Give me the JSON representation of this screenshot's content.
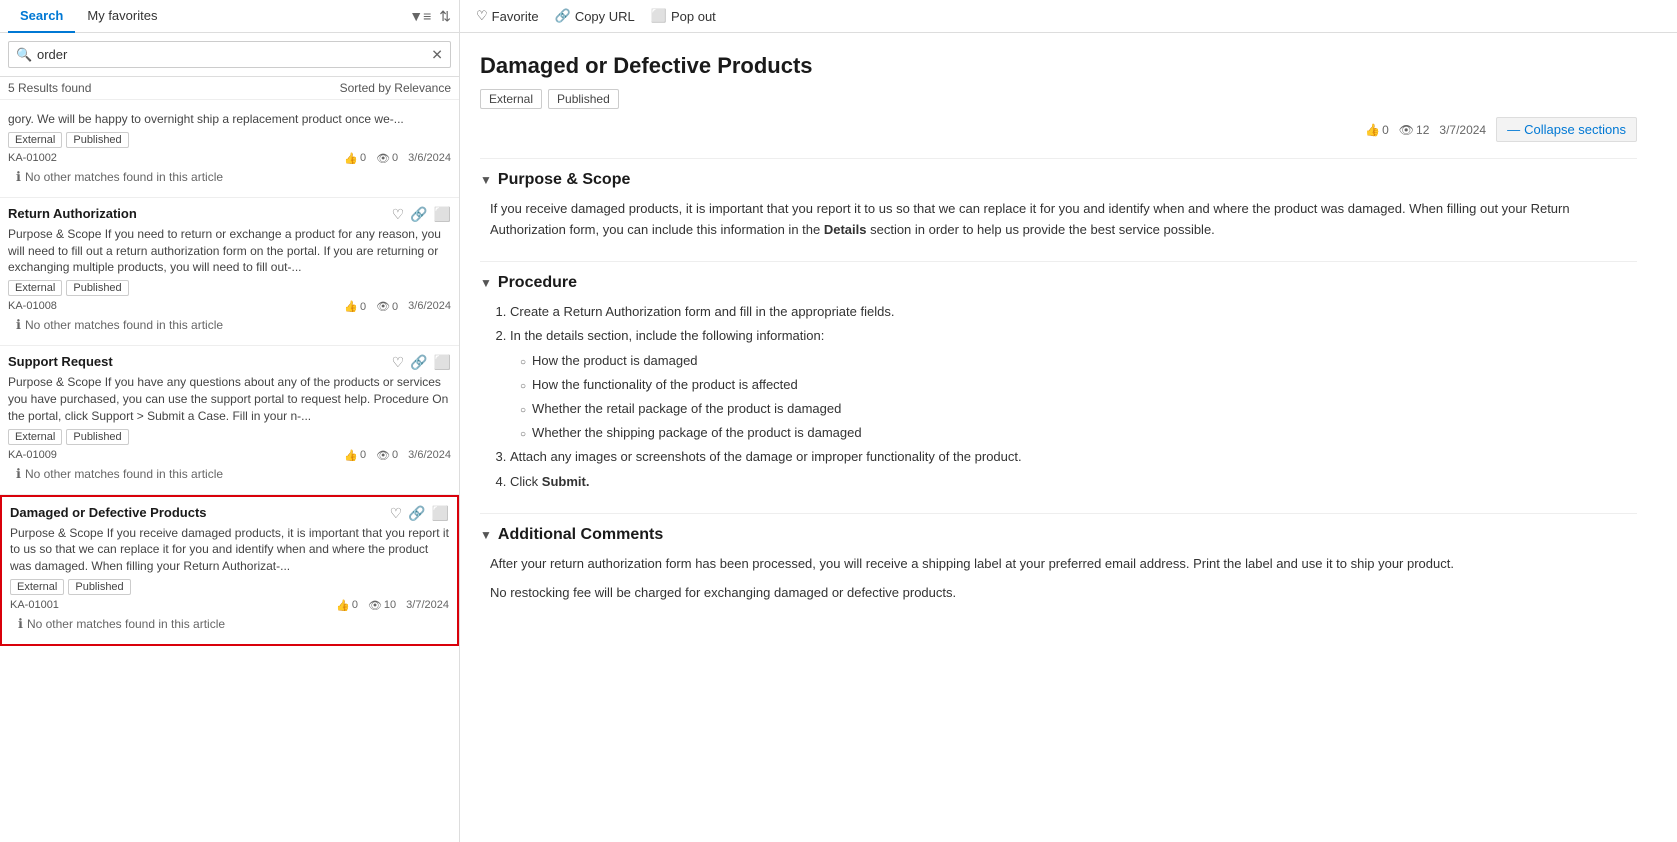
{
  "left": {
    "tabs": [
      {
        "label": "Search",
        "active": true
      },
      {
        "label": "My favorites",
        "active": false
      }
    ],
    "search": {
      "value": "order",
      "placeholder": "order"
    },
    "results_header": {
      "count": "5 Results found",
      "sort": "Sorted by Relevance"
    },
    "results": [
      {
        "id": "r1",
        "title": null,
        "snippet": "gory. We will be happy to overnight ship a replacement product once we-...",
        "tags": [
          "External",
          "Published"
        ],
        "ka": "KA-01002",
        "likes": "0",
        "views": "0",
        "date": "3/6/2024",
        "no_match": "No other matches found in this article",
        "selected": false,
        "highlighted": false
      },
      {
        "id": "r2",
        "title": "Return Authorization",
        "snippet": "Purpose & Scope If you need to return or exchange a product for any reason, you will need to fill out a return authorization form on the portal. If you are returning or exchanging multiple products, you will need to fill out-...",
        "tags": [
          "External",
          "Published"
        ],
        "ka": "KA-01008",
        "likes": "0",
        "views": "0",
        "date": "3/6/2024",
        "no_match": "No other matches found in this article",
        "selected": false,
        "highlighted": false
      },
      {
        "id": "r3",
        "title": "Support Request",
        "snippet": "Purpose & Scope If you have any questions about any of the products or services you have purchased, you can use the support portal to request help. Procedure On the portal, click Support > Submit a Case. Fill in your n-...",
        "tags": [
          "External",
          "Published"
        ],
        "ka": "KA-01009",
        "likes": "0",
        "views": "0",
        "date": "3/6/2024",
        "no_match": "No other matches found in this article",
        "selected": false,
        "highlighted": false
      },
      {
        "id": "r4",
        "title": "Damaged or Defective Products",
        "snippet": "Purpose & Scope If you receive damaged products, it is important that you report it to us so that we can replace it for you and identify when and where the product was damaged. When filling your Return Authorizat-...",
        "tags": [
          "External",
          "Published"
        ],
        "ka": "KA-01001",
        "likes": "0",
        "views": "10",
        "date": "3/7/2024",
        "no_match": "No other matches found in this article",
        "selected": false,
        "highlighted": true
      }
    ]
  },
  "right": {
    "toolbar": {
      "favorite_label": "Favorite",
      "copy_label": "Copy URL",
      "popout_label": "Pop out"
    },
    "article": {
      "title": "Damaged or Defective Products",
      "tags": [
        "External",
        "Published"
      ],
      "likes": "0",
      "views": "12",
      "date": "3/7/2024",
      "collapse_label": "Collapse sections",
      "sections": [
        {
          "id": "s1",
          "title": "Purpose & Scope",
          "body": "If you receive damaged products, it is important that you report it to us so that we can replace it for you and identify when and where the product was damaged. When filling out your Return Authorization form, you can include this information in the Details section in order to help us provide the best service possible."
        },
        {
          "id": "s2",
          "title": "Procedure",
          "ordered_items": [
            "Create a Return Authorization form and fill in the appropriate fields.",
            "In the details section, include the following information:",
            "Attach any images or screenshots of the damage or improper functionality of the product.",
            "Click Submit."
          ],
          "sub_items": [
            "How the product is damaged",
            "How the functionality of the product is affected",
            "Whether the retail package of the product is damaged",
            "Whether the shipping package of the product is damaged"
          ]
        },
        {
          "id": "s3",
          "title": "Additional Comments",
          "lines": [
            "After your return authorization form has been processed, you will receive a shipping label at your preferred email address. Print the label and use it to ship your product.",
            "No restocking fee will be charged for exchanging damaged or defective products."
          ]
        }
      ]
    }
  }
}
